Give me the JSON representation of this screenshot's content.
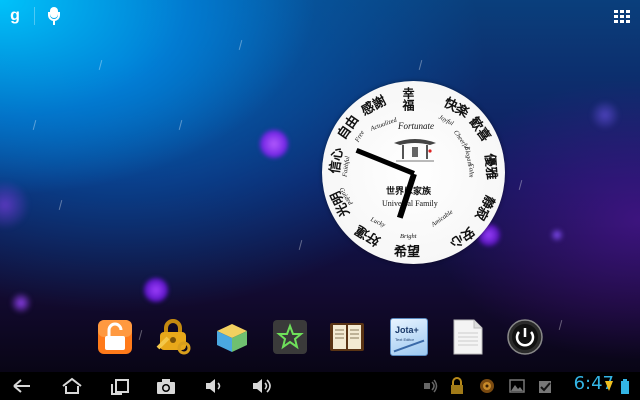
{
  "top_bar": {
    "google_search_glyph": "g",
    "icons": [
      "google-search-icon",
      "voice-search-icon",
      "all-apps-icon"
    ]
  },
  "clock_widget": {
    "center": {
      "title": "Fortunate",
      "kanji": "世界は家族",
      "subtitle": "Universal Family"
    },
    "ring_kanji": [
      "幸福",
      "快楽",
      "歓喜",
      "優雅",
      "静寂",
      "安心",
      "希望",
      "好運",
      "光明",
      "信心",
      "自由",
      "感謝"
    ],
    "ring_english": [
      "Actualized",
      "Joyful",
      "Cheerful",
      "Elegant",
      "Calm",
      "Amicable",
      "Bright",
      "Lucky",
      "Guided",
      "Faithful",
      "Free"
    ],
    "time_hour": 7,
    "time_minute": 47
  },
  "dock": {
    "apps": [
      {
        "name": "unlock-app",
        "icon": "padlock-open-icon"
      },
      {
        "name": "key-lock-app",
        "icon": "golden-lock-icon"
      },
      {
        "name": "cube-app",
        "icon": "cube-icon"
      },
      {
        "name": "star-app",
        "icon": "star-icon"
      },
      {
        "name": "diary-app",
        "icon": "book-icon"
      },
      {
        "name": "jota-text-editor",
        "icon": "jota-icon",
        "label": "Jota+",
        "sublabel": "Text Editor"
      },
      {
        "name": "document-app",
        "icon": "document-icon"
      },
      {
        "name": "power-app",
        "icon": "power-icon"
      }
    ]
  },
  "nav_bar": {
    "buttons": [
      "back-icon",
      "home-icon",
      "recent-apps-icon",
      "screenshot-icon",
      "volume-down-icon",
      "volume-up-icon"
    ],
    "status_icons": [
      "cast-icon",
      "lock-icon",
      "media-icon",
      "gallery-icon",
      "checkbox-icon",
      "wifi-icon",
      "battery-icon"
    ],
    "time": "6:47",
    "accent_color": "#33b5e5"
  }
}
